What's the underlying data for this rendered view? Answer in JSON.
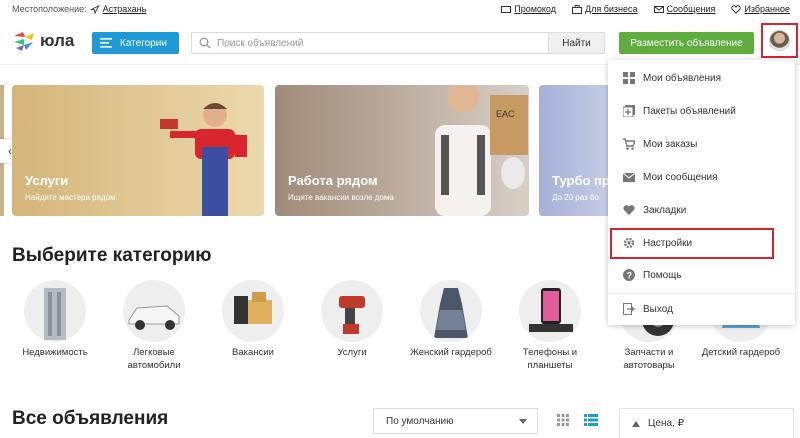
{
  "topbar": {
    "location_label": "Местоположение:",
    "location_value": "Астрахань",
    "links": [
      "Промокод",
      "Для бизнеса",
      "Сообщения",
      "Избранное"
    ]
  },
  "header": {
    "logo_text": "юла",
    "categories_button": "Категории",
    "search_placeholder": "Поиск объявлений",
    "search_button": "Найти",
    "post_button": "Разместить объявление"
  },
  "banners": [
    {
      "title": "Услуги",
      "subtitle": "Найдите мастера рядом"
    },
    {
      "title": "Работа рядом",
      "subtitle": "Ищите вакансии возле дома"
    },
    {
      "title": "Турбо пр",
      "subtitle": "До 20 раз бо"
    }
  ],
  "categories": {
    "heading": "Выберите категорию",
    "items": [
      "Недвижимость",
      "Легковые автомобили",
      "Вакансии",
      "Услуги",
      "Женский гардероб",
      "Телефоны и планшеты",
      "Запчасти и автотовары",
      "Детский гардероб"
    ]
  },
  "listings": {
    "heading": "Все объявления",
    "sort_value": "По умолчанию",
    "price_label": "Цена, ₽"
  },
  "user_menu": {
    "items": [
      {
        "label": "Мои объявления",
        "icon": "grid-icon"
      },
      {
        "label": "Пакеты объявлений",
        "icon": "plus-box-icon"
      },
      {
        "label": "Мои заказы",
        "icon": "cart-icon"
      },
      {
        "label": "Мои сообщения",
        "icon": "envelope-icon"
      },
      {
        "label": "Закладки",
        "icon": "heart-icon"
      },
      {
        "label": "Настройки",
        "icon": "gear-icon"
      },
      {
        "label": "Помощь",
        "icon": "help-icon"
      },
      {
        "label": "Выход",
        "icon": "logout-icon"
      }
    ],
    "highlighted": "Настройки"
  },
  "colors": {
    "accent_blue": "#1e9ad6",
    "accent_green": "#5fad3f",
    "highlight_red": "#d9232d"
  }
}
